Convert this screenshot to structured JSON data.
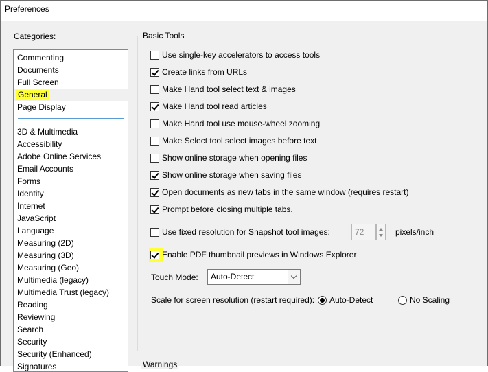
{
  "window": {
    "title": "Preferences"
  },
  "sidebar": {
    "label": "Categories:",
    "top_items": [
      "Commenting",
      "Documents",
      "Full Screen",
      "General",
      "Page Display"
    ],
    "selected": "General",
    "items": [
      "3D & Multimedia",
      "Accessibility",
      "Adobe Online Services",
      "Email Accounts",
      "Forms",
      "Identity",
      "Internet",
      "JavaScript",
      "Language",
      "Measuring (2D)",
      "Measuring (3D)",
      "Measuring (Geo)",
      "Multimedia (legacy)",
      "Multimedia Trust (legacy)",
      "Reading",
      "Reviewing",
      "Search",
      "Security",
      "Security (Enhanced)",
      "Signatures"
    ]
  },
  "basic_tools": {
    "title": "Basic Tools",
    "options": [
      {
        "label": "Use single-key accelerators to access tools",
        "checked": false
      },
      {
        "label": "Create links from URLs",
        "checked": true
      },
      {
        "label": "Make Hand tool select text & images",
        "checked": false
      },
      {
        "label": "Make Hand tool read articles",
        "checked": true
      },
      {
        "label": "Make Hand tool use mouse-wheel zooming",
        "checked": false
      },
      {
        "label": "Make Select tool select images before text",
        "checked": false
      },
      {
        "label": "Show online storage when opening files",
        "checked": false
      },
      {
        "label": "Show online storage when saving files",
        "checked": true
      },
      {
        "label": "Open documents as new tabs in the same window (requires restart)",
        "checked": true
      },
      {
        "label": "Prompt before closing multiple tabs.",
        "checked": true
      }
    ],
    "snapshot": {
      "label": "Use fixed resolution for Snapshot tool images:",
      "checked": false,
      "value": "72",
      "units": "pixels/inch"
    },
    "thumbnail": {
      "label": "Enable PDF thumbnail previews in Windows Explorer",
      "checked": true
    },
    "touch_mode": {
      "label": "Touch Mode:",
      "value": "Auto-Detect"
    },
    "scale": {
      "label": "Scale for screen resolution (restart required):",
      "options": [
        "Auto-Detect",
        "No Scaling"
      ],
      "selected": "Auto-Detect"
    }
  },
  "warnings": {
    "title": "Warnings"
  }
}
